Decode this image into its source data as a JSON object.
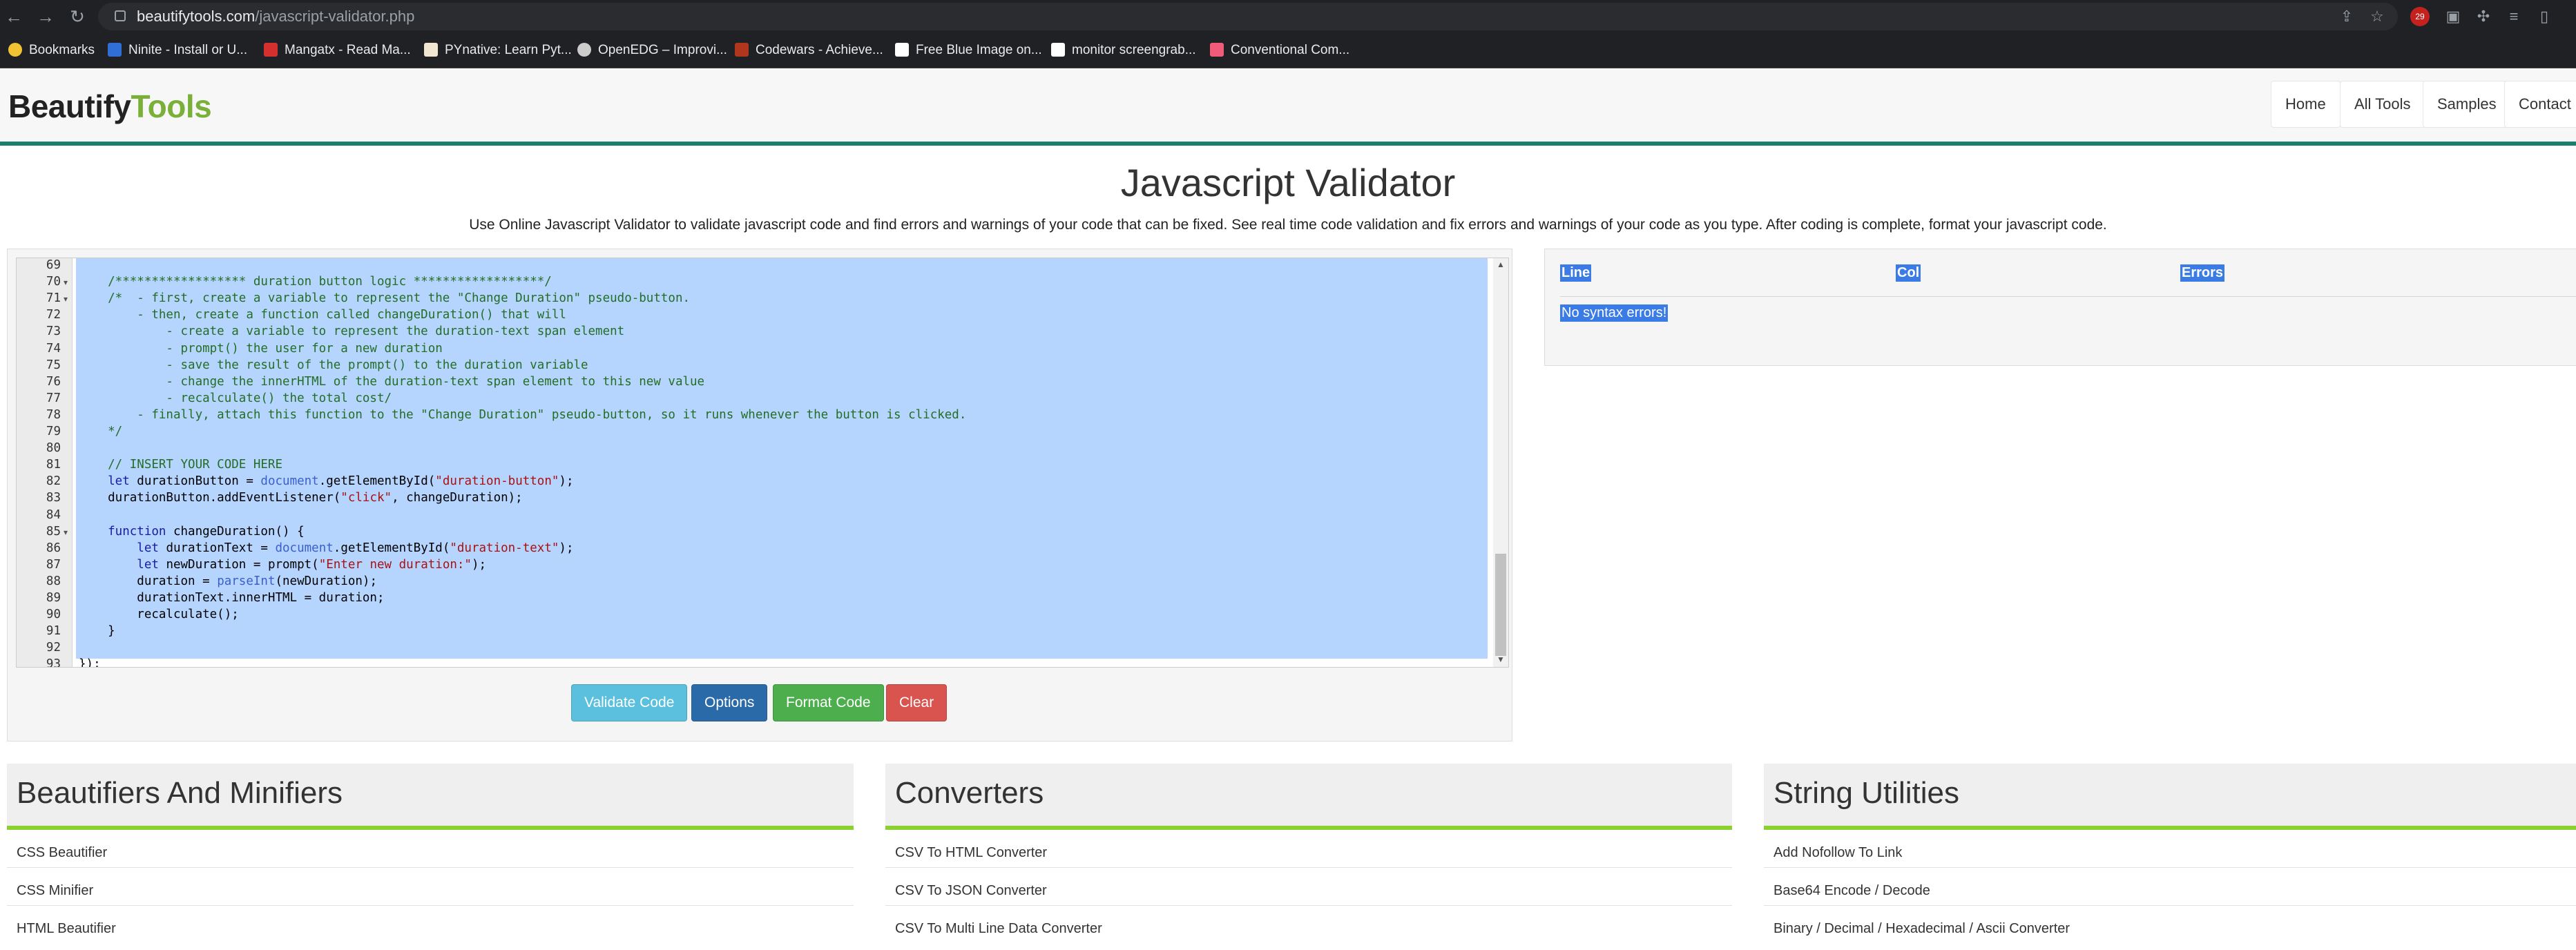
{
  "browser": {
    "url_host": "beautifytools.com",
    "url_path": "/javascript-validator.php",
    "badge": "29",
    "bookmarks": [
      {
        "label": "Bookmarks",
        "color": "#f1c232"
      },
      {
        "label": "Ninite - Install or U...",
        "color": "#2f6fd6"
      },
      {
        "label": "Mangatx - Read Ma...",
        "color": "#d62f2f"
      },
      {
        "label": "PYnative: Learn Pyt...",
        "color": "#f2e6d0"
      },
      {
        "label": "OpenEDG – Improvi...",
        "color": "#cccccc"
      },
      {
        "label": "Codewars - Achieve...",
        "color": "#b1361e"
      },
      {
        "label": "Free Blue Image on...",
        "color": "#ffffff"
      },
      {
        "label": "monitor screengrab...",
        "color": "#ffffff"
      },
      {
        "label": "Conventional Com...",
        "color": "#f05b79"
      }
    ]
  },
  "site": {
    "logo_a": "Beautify",
    "logo_b": "Tools",
    "nav": [
      "Home",
      "All Tools",
      "Samples",
      "Contact"
    ]
  },
  "main": {
    "title": "Javascript Validator",
    "description": "Use Online Javascript Validator to validate javascript code and find errors and warnings of your code that can be fixed. See real time code validation and fix errors and warnings of your code as you type. After coding is complete, format your javascript code."
  },
  "editor": {
    "lines": [
      {
        "n": "69",
        "fold": false,
        "tokens": []
      },
      {
        "n": "70",
        "fold": true,
        "tokens": [
          {
            "t": "    /****************** duration button logic ******************/",
            "c": "comment"
          }
        ]
      },
      {
        "n": "71",
        "fold": true,
        "tokens": [
          {
            "t": "    /*  - first, create a variable to represent the \"Change Duration\" pseudo-button.",
            "c": "comment"
          }
        ]
      },
      {
        "n": "72",
        "fold": false,
        "tokens": [
          {
            "t": "        - then, create a function called changeDuration() that will",
            "c": "comment"
          }
        ]
      },
      {
        "n": "73",
        "fold": false,
        "tokens": [
          {
            "t": "            - create a variable to represent the duration-text span element",
            "c": "comment"
          }
        ]
      },
      {
        "n": "74",
        "fold": false,
        "tokens": [
          {
            "t": "            - prompt() the user for a new duration",
            "c": "comment"
          }
        ]
      },
      {
        "n": "75",
        "fold": false,
        "tokens": [
          {
            "t": "            - save the result of the prompt() to the duration variable",
            "c": "comment"
          }
        ]
      },
      {
        "n": "76",
        "fold": false,
        "tokens": [
          {
            "t": "            - change the innerHTML of the duration-text span element to this new value",
            "c": "comment"
          }
        ]
      },
      {
        "n": "77",
        "fold": false,
        "tokens": [
          {
            "t": "            - recalculate() the total cost/",
            "c": "comment"
          }
        ]
      },
      {
        "n": "78",
        "fold": false,
        "tokens": [
          {
            "t": "        - finally, attach this function to the \"Change Duration\" pseudo-button, so it runs whenever the button is clicked.",
            "c": "comment"
          }
        ]
      },
      {
        "n": "79",
        "fold": false,
        "tokens": [
          {
            "t": "    */",
            "c": "comment"
          }
        ]
      },
      {
        "n": "80",
        "fold": false,
        "tokens": []
      },
      {
        "n": "81",
        "fold": false,
        "tokens": [
          {
            "t": "    // INSERT YOUR CODE HERE",
            "c": "comment"
          }
        ]
      },
      {
        "n": "82",
        "fold": false,
        "tokens": [
          {
            "t": "    let ",
            "c": "kw"
          },
          {
            "t": "durationButton = ",
            "c": "plain"
          },
          {
            "t": "document",
            "c": "builtin"
          },
          {
            "t": ".getElementById(",
            "c": "plain"
          },
          {
            "t": "\"duration-button\"",
            "c": "str"
          },
          {
            "t": ");",
            "c": "plain"
          }
        ]
      },
      {
        "n": "83",
        "fold": false,
        "tokens": [
          {
            "t": "    durationButton.addEventListener(",
            "c": "plain"
          },
          {
            "t": "\"click\"",
            "c": "str"
          },
          {
            "t": ", changeDuration);",
            "c": "plain"
          }
        ]
      },
      {
        "n": "84",
        "fold": false,
        "tokens": []
      },
      {
        "n": "85",
        "fold": true,
        "tokens": [
          {
            "t": "    function ",
            "c": "kw"
          },
          {
            "t": "changeDuration() {",
            "c": "plain"
          }
        ]
      },
      {
        "n": "86",
        "fold": false,
        "tokens": [
          {
            "t": "        let ",
            "c": "kw"
          },
          {
            "t": "durationText = ",
            "c": "plain"
          },
          {
            "t": "document",
            "c": "builtin"
          },
          {
            "t": ".getElementById(",
            "c": "plain"
          },
          {
            "t": "\"duration-text\"",
            "c": "str"
          },
          {
            "t": ");",
            "c": "plain"
          }
        ]
      },
      {
        "n": "87",
        "fold": false,
        "tokens": [
          {
            "t": "        let ",
            "c": "kw"
          },
          {
            "t": "newDuration = prompt(",
            "c": "plain"
          },
          {
            "t": "\"Enter new duration:\"",
            "c": "str"
          },
          {
            "t": ");",
            "c": "plain"
          }
        ]
      },
      {
        "n": "88",
        "fold": false,
        "tokens": [
          {
            "t": "        duration = ",
            "c": "plain"
          },
          {
            "t": "parseInt",
            "c": "builtin"
          },
          {
            "t": "(newDuration);",
            "c": "plain"
          }
        ]
      },
      {
        "n": "89",
        "fold": false,
        "tokens": [
          {
            "t": "        durationText.innerHTML = duration;",
            "c": "plain"
          }
        ]
      },
      {
        "n": "90",
        "fold": false,
        "tokens": [
          {
            "t": "        recalculate();",
            "c": "plain"
          }
        ]
      },
      {
        "n": "91",
        "fold": false,
        "tokens": [
          {
            "t": "    }",
            "c": "plain"
          }
        ]
      },
      {
        "n": "92",
        "fold": false,
        "tokens": []
      },
      {
        "n": "93",
        "fold": false,
        "tokens": [
          {
            "t": "});",
            "c": "plain"
          }
        ]
      }
    ]
  },
  "buttons": {
    "validate": "Validate Code",
    "options": "Options",
    "format": "Format Code",
    "clear": "Clear"
  },
  "results": {
    "col_line": "Line",
    "col_col": "Col",
    "col_errors": "Errors",
    "message": "No syntax errors!"
  },
  "cards": [
    {
      "title": "Beautifiers And Minifiers",
      "items": [
        "CSS Beautifier",
        "CSS Minifier",
        "HTML Beautifier"
      ]
    },
    {
      "title": "Converters",
      "items": [
        "CSV To HTML Converter",
        "CSV To JSON Converter",
        "CSV To Multi Line Data Converter"
      ]
    },
    {
      "title": "String Utilities",
      "items": [
        "Add Nofollow To Link",
        "Base64 Encode / Decode",
        "Binary / Decimal / Hexadecimal / Ascii Converter"
      ]
    }
  ],
  "colors": {
    "accent_teal": "#1a7f6e",
    "logo_green": "#7ab03a",
    "card_underline": "#8bd130",
    "selection": "#b5d5ff",
    "btn_validate": "#5bc0de",
    "btn_options": "#337ab7",
    "btn_format": "#5cb85c",
    "btn_clear": "#d9534f"
  }
}
